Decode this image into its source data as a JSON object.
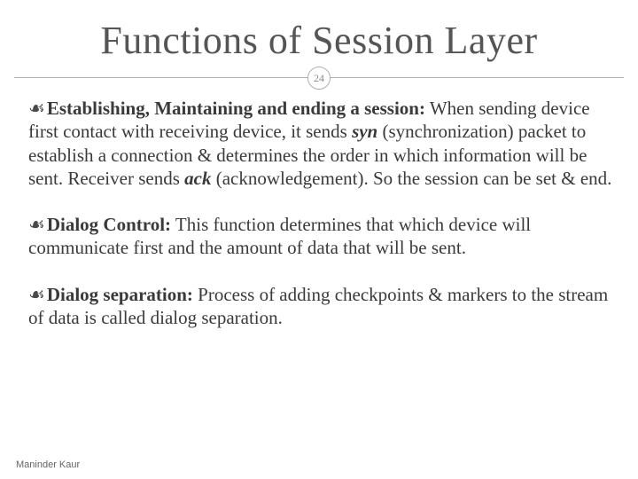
{
  "page_number": "24",
  "title": "Functions of Session Layer",
  "bullets": [
    {
      "heading": "Establishing, Maintaining and ending a session:",
      "pre1": " When sending device first contact with receiving device, it sends ",
      "em1": "syn",
      "mid1": " (synchronization) packet to establish a connection & determines the order in which information will be sent. Receiver sends ",
      "em2": "ack",
      "post1": " (acknowledgement). So the session can be set & end."
    },
    {
      "heading": "Dialog Control:",
      "body": " This function determines that which device will communicate first and the amount of data that will be sent."
    },
    {
      "heading": "Dialog separation:",
      "body": " Process of adding checkpoints & markers to the stream of data is called dialog separation."
    }
  ],
  "author": "Maninder Kaur",
  "bullet_glyph": "☙"
}
